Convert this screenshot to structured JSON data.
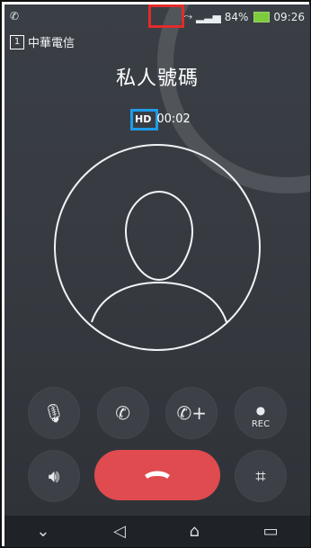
{
  "status": {
    "left_icon": "phone-icon",
    "battery": "84%",
    "time": "09:26",
    "signal": "signal-icon",
    "wifi": "wifi-icon"
  },
  "carrier": {
    "sim_slot": "1",
    "name": "中華電信"
  },
  "call": {
    "title": "私人號碼",
    "hd_label": "HD",
    "duration": "00:02"
  },
  "buttons": {
    "rec_label": "REC"
  },
  "colors": {
    "end_call": "#e04b4f",
    "annotation_red": "#e32b2b",
    "annotation_blue": "#1f9bea"
  }
}
